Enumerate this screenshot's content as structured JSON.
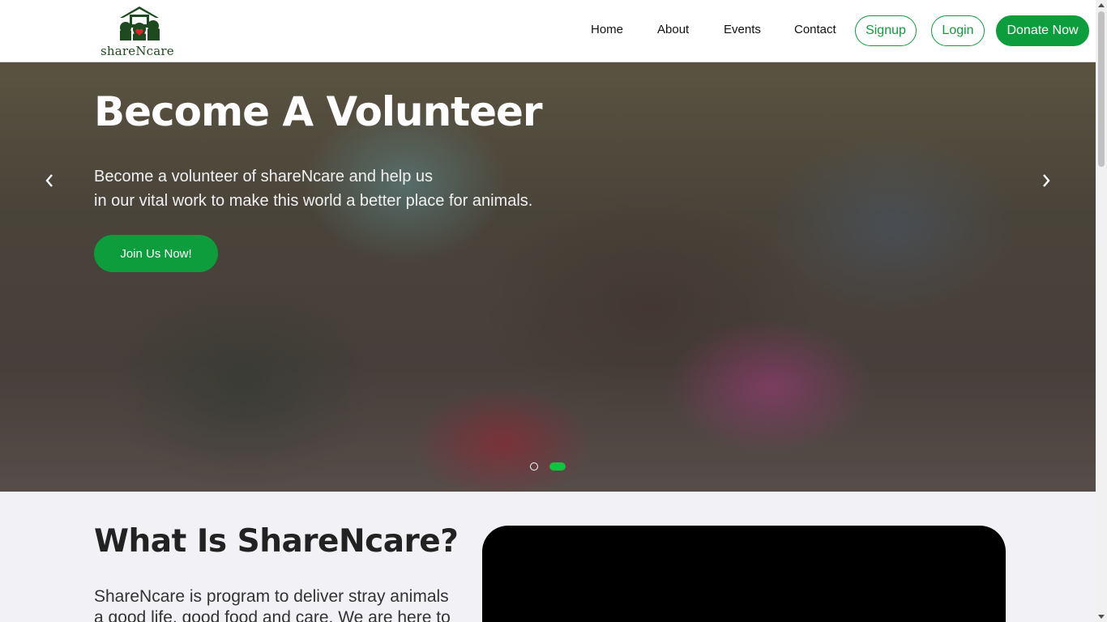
{
  "brand": {
    "logo_text": "shareNcare"
  },
  "nav": {
    "links": [
      "Home",
      "About",
      "Events",
      "Contact"
    ],
    "signup": "Signup",
    "login": "Login",
    "donate": "Donate Now"
  },
  "hero": {
    "title": "Become A Volunteer",
    "subtitle_line1": "Become a volunteer of shareNcare and help us",
    "subtitle_line2": "in our vital work to make this world a better place for animals.",
    "cta": "Join Us Now!",
    "slides_total": 2,
    "active_slide": 2
  },
  "about": {
    "title": "What Is ShareNcare?",
    "text_line1": "ShareNcare is program to deliver stray animals",
    "text_line2": "a good life, good food and care. We are here to"
  },
  "colors": {
    "accent": "#0e9d3c",
    "active_dot": "#15c23f",
    "logo_green": "#1d4a1e"
  },
  "icons": [
    "house-logo-icon",
    "chevron-left-icon",
    "chevron-right-icon"
  ]
}
